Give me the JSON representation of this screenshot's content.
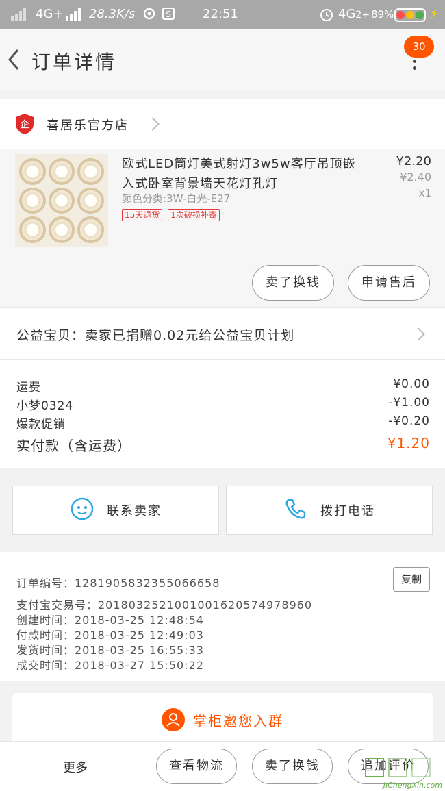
{
  "status_bar": {
    "network_1": "4G+",
    "speed": "28.3K/s",
    "time": "22:51",
    "network_2": "4G",
    "network_2_suffix": "2+",
    "battery": "89%"
  },
  "header": {
    "title": "订单详情",
    "badge_count": "30"
  },
  "shop": {
    "name": "喜居乐官方店"
  },
  "product": {
    "title": "欧式LED筒灯美式射灯3w5w客厅吊顶嵌入式卧室背景墙天花灯孔灯",
    "sku": "颜色分类:3W-白光-E27",
    "tags": [
      "15天退货",
      "1次破损补寄"
    ],
    "price": "¥2.20",
    "original_price": "¥2.40",
    "quantity": "x1",
    "actions": [
      "卖了换钱",
      "申请售后"
    ]
  },
  "charity": {
    "text": "公益宝贝：卖家已捐赠0.02元给公益宝贝计划"
  },
  "fees": [
    {
      "label": "运费",
      "value": "¥0.00"
    },
    {
      "label": "小梦0324",
      "value": "-¥1.00"
    },
    {
      "label": "爆款促销",
      "value": "-¥0.20"
    }
  ],
  "total": {
    "label": "实付款（含运费）",
    "value": "¥1.20"
  },
  "contact": {
    "seller": "联系卖家",
    "call": "拨打电话"
  },
  "order_info": {
    "order_no": "订单编号：1281905832355066658",
    "alipay_no": "支付宝交易号：2018032521001001620574978960",
    "created": "创建时间：2018-03-25  12:48:54",
    "paid": "付款时间：2018-03-25  12:49:03",
    "shipped": "发货时间：2018-03-25  16:55:33",
    "completed": "成交时间：2018-03-27  15:50:22",
    "copy_label": "复制"
  },
  "group": {
    "text": "掌柜邀您入群"
  },
  "bottom_bar": {
    "more": "更多",
    "actions": [
      "查看物流",
      "卖了换钱",
      "追加评价"
    ]
  },
  "watermark": {
    "text": "JiChengXin.com"
  },
  "colors": {
    "accent": "#ff5500",
    "tag_red": "#e43c3c",
    "status_bar": "#a8a8a8"
  }
}
